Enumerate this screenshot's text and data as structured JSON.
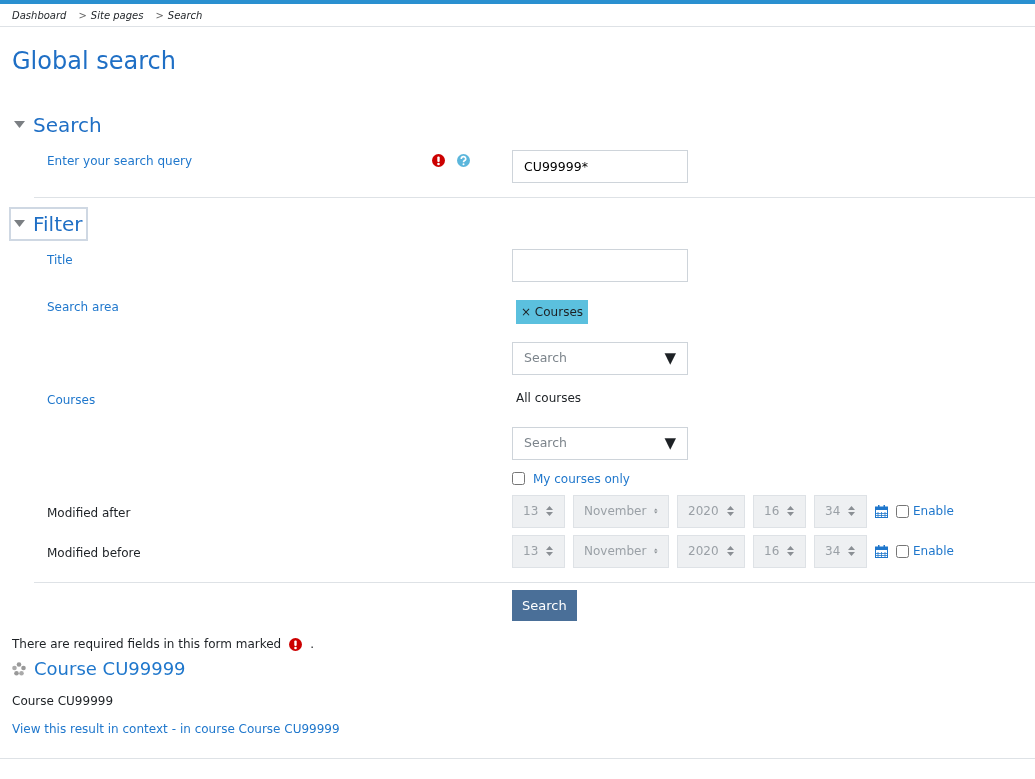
{
  "breadcrumb": [
    {
      "label": "Dashboard"
    },
    {
      "separator": ">",
      "label": "Site pages"
    },
    {
      "separator": ">",
      "label": "Search"
    }
  ],
  "page_title": "Global search",
  "sections": [
    {
      "title": "Search",
      "expanded": true,
      "focused": false,
      "fields": [
        {
          "kind": "text",
          "label": "Enter your search query",
          "required": true,
          "help": true,
          "value": "CU99999*"
        }
      ]
    },
    {
      "title": "Filter",
      "expanded": true,
      "focused": true,
      "fields": [
        {
          "kind": "text",
          "label": "Title",
          "required": false,
          "help": false
        },
        {
          "kind": "autocomplete",
          "label": "Search area",
          "tags": [
            {
              "remove": "×",
              "label": "Courses"
            }
          ],
          "placeholder": "Search",
          "arrow": "▼"
        },
        {
          "kind": "autocomplete",
          "label": "Courses",
          "selection_text": "All courses",
          "placeholder": "Search",
          "arrow": "▼",
          "checkbox": {
            "label": "My courses only",
            "checked": false
          }
        },
        {
          "kind": "date",
          "label": "Modified after",
          "parts": [
            "13",
            "November",
            "2020",
            "16",
            "34"
          ],
          "disabled": true,
          "enable": {
            "label": "Enable",
            "checked": false
          }
        },
        {
          "kind": "date",
          "label": "Modified before",
          "parts": [
            "13",
            "November",
            "2020",
            "16",
            "34"
          ],
          "disabled": true,
          "enable": {
            "label": "Enable",
            "checked": false
          }
        }
      ]
    }
  ],
  "submit": "Search",
  "required_note": {
    "text": "There are required fields in this form marked",
    "suffix": "."
  },
  "results": [
    {
      "title": "Course CU99999",
      "content": "Course CU99999",
      "context_link": "View this result in context",
      "course_text": "- in course Course CU99999"
    }
  ]
}
